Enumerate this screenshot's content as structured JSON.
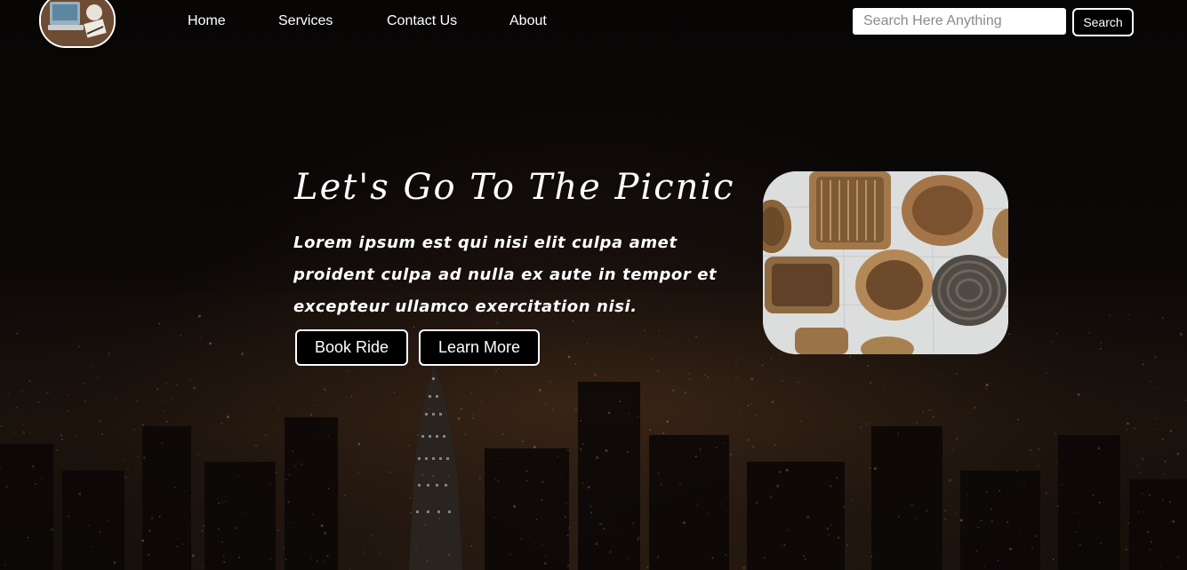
{
  "nav": {
    "logo_icon": "desk-laptop-logo-icon",
    "links": [
      "Home",
      "Services",
      "Contact Us",
      "About"
    ]
  },
  "search": {
    "placeholder": "Search Here Anything",
    "value": "",
    "button_label": "Search"
  },
  "hero": {
    "title": "Let's Go To The Picnic",
    "text": "Lorem ipsum est qui nisi elit culpa amet proident culpa ad nulla ex aute in tempor et excepteur ullamco exercitation nisi.",
    "primary_button": "Book Ride",
    "secondary_button": "Learn More",
    "image_icon": "wicker-baskets-image"
  },
  "colors": {
    "background": "#0a0606",
    "text": "#ffffff",
    "button_bg": "#000000",
    "button_border": "#ffffff"
  }
}
